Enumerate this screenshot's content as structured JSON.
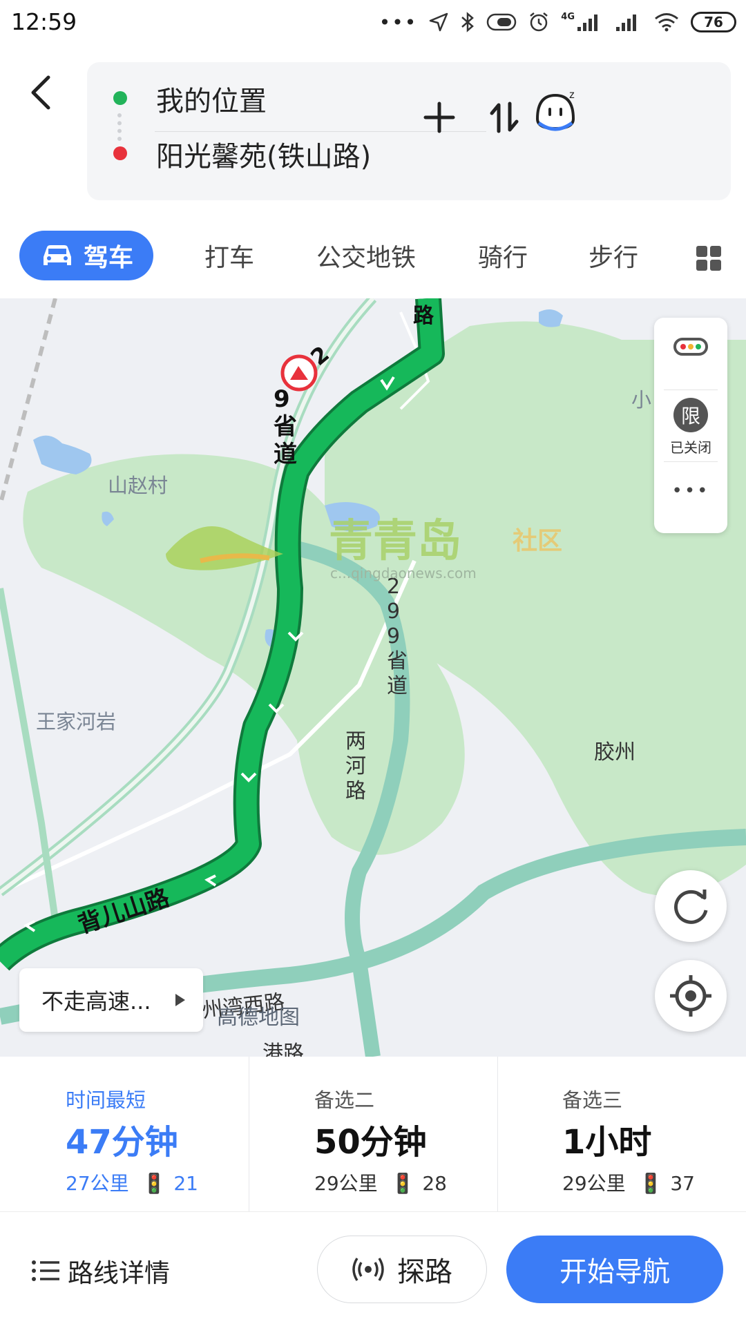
{
  "status_bar": {
    "time": "12:59",
    "network": "4G",
    "battery": "76"
  },
  "route": {
    "origin": "我的位置",
    "destination": "阳光馨苑(铁山路)",
    "origin_color": "#22b35a",
    "destination_color": "#e8323c"
  },
  "modes": [
    {
      "label": "驾车",
      "active": true
    },
    {
      "label": "打车",
      "active": false
    },
    {
      "label": "公交地铁",
      "active": false
    },
    {
      "label": "骑行",
      "active": false
    },
    {
      "label": "步行",
      "active": false
    }
  ],
  "map": {
    "road_labels": {
      "s299_vertical": "9省道",
      "s299_digit_top": "2",
      "beiershan": "背儿山路",
      "s299_alt": "299省道",
      "lianghe": "两河路",
      "jiaozhou": "胶州",
      "jiaoxi": "州湾西路",
      "road_bottom": "港路",
      "top_road": "路"
    },
    "place_labels": {
      "shanzhao": "山赵村",
      "wangjia": "王家河岩",
      "xiao": "小"
    },
    "watermark": "青青岛",
    "watermark_sub": "社区",
    "watermark_url": "c...qingdaonews.com",
    "amap_logo": "高德地图",
    "traffic_limit_icon_text": "限",
    "traffic_limit_status": "已关闭",
    "avoid_highway": "不走高速...",
    "route_color": "#16b85a",
    "alt_route_color": "#8fcfbb"
  },
  "options": [
    {
      "label": "时间最短",
      "time": "47分钟",
      "distance": "27公里",
      "lights": "21"
    },
    {
      "label": "备选二",
      "time": "50分钟",
      "distance": "29公里",
      "lights": "28"
    },
    {
      "label": "备选三",
      "time": "1小时",
      "distance": "29公里",
      "lights": "37"
    }
  ],
  "bottom": {
    "detail": "路线详情",
    "explore": "探路",
    "start_nav": "开始导航"
  },
  "colors": {
    "accent": "#3b7cf6"
  }
}
